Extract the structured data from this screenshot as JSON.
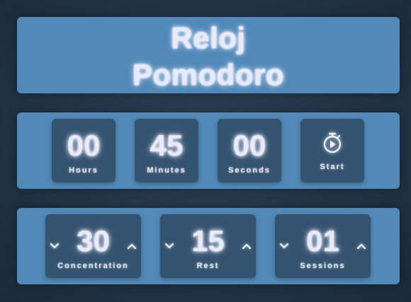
{
  "header": {
    "title_line1": "Reloj",
    "title_line2": "Pomodoro"
  },
  "timer": {
    "hours": {
      "value": "00",
      "label": "Hours"
    },
    "minutes": {
      "value": "45",
      "label": "Minutes"
    },
    "seconds": {
      "value": "00",
      "label": "Seconds"
    },
    "start": {
      "label": "Start",
      "icon": "stopwatch-play-icon"
    }
  },
  "settings": {
    "concentration": {
      "value": "30",
      "label": "Concentration"
    },
    "rest": {
      "value": "15",
      "label": "Rest"
    },
    "sessions": {
      "value": "01",
      "label": "Sessions"
    },
    "decrement_icon": "chevron-down-icon",
    "increment_icon": "chevron-up-icon"
  },
  "colors": {
    "background": "#223445",
    "panel": "#5189b8",
    "box": "#34536f",
    "text_glow": "#e8eaf9"
  }
}
